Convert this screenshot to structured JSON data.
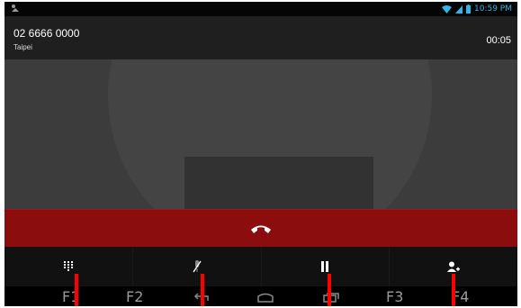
{
  "status_bar": {
    "time": "10:59 PM"
  },
  "call": {
    "number": "02 6666 0000",
    "location": "Taipei",
    "duration": "00:05"
  },
  "nav_labels": {
    "f1": "F1",
    "f2": "F2",
    "f3": "F3",
    "f4": "F4"
  },
  "colors": {
    "end_call_bar": "#8b0d0d",
    "annotation_line": "#ff0000",
    "status_accent": "#33b5e5"
  }
}
